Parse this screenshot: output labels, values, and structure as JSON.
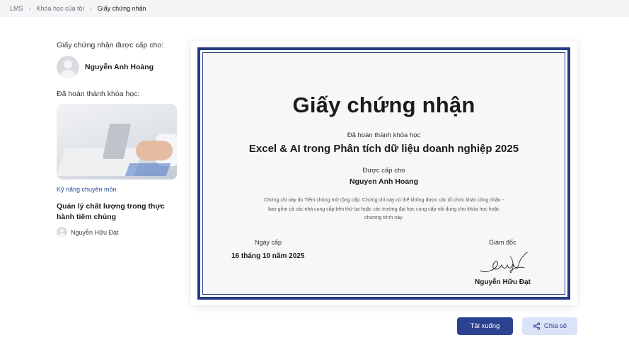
{
  "breadcrumb": {
    "items": [
      "LMS",
      "Khóa học của tôi",
      "Giấy chứng nhận"
    ]
  },
  "sidebar": {
    "issued_to_label": "Giấy chứng nhận được cấp cho:",
    "recipient_name": "Nguyễn Anh Hoàng",
    "completed_label": "Đã hoàn thành khóa học:",
    "course": {
      "category": "Kỹ năng chuyên môn",
      "title": "Quản lý chất lượng trong thực hành tiêm chủng",
      "instructor": "Nguyễn Hữu Đạt"
    }
  },
  "certificate": {
    "title": "Giấy chứng nhận",
    "completed_text": "Đã hoàn thành khóa học",
    "course_name": "Excel & AI trong Phân tích dữ liệu doanh nghiệp 2025",
    "awarded_to_label": "Được cấp cho",
    "recipient": "Nguyen Anh Hoang",
    "note": "Chứng chỉ này do Tiêm chủng mở rộng cấp. Chứng chỉ này có thể không được các tổ chức khác công nhận - bao gồm cả các nhà cung cấp bên thứ ba hoặc các trường đại học cung cấp nội dung cho khóa học hoặc chương trình này.",
    "issue_date_label": "Ngày cấp",
    "issue_date": "16 tháng 10 năm 2025",
    "director_label": "Giám đốc",
    "signer": "Nguyễn Hữu Đạt"
  },
  "actions": {
    "download_label": "Tải xuống",
    "share_label": "Chia sẻ"
  },
  "colors": {
    "brand": "#2b4290",
    "frame": "#253a80",
    "share_bg": "#dbe3f6",
    "breadcrumb_bg": "#f4f5f7"
  },
  "icons": {
    "breadcrumb_separator": "chevron-right-icon",
    "share": "share-icon"
  }
}
